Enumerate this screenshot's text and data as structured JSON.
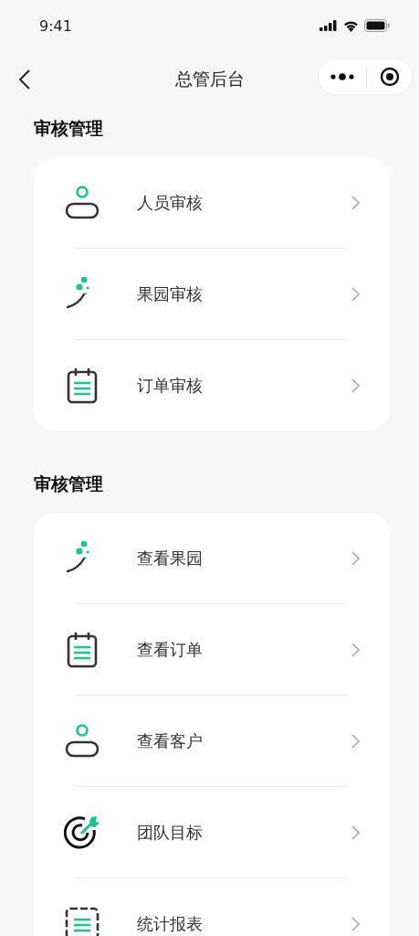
{
  "status_bar": {
    "time": "9:41"
  },
  "nav": {
    "title": "总管后台"
  },
  "sections": [
    {
      "title": "审核管理",
      "items": [
        {
          "label": "人员审核",
          "kind": "person"
        },
        {
          "label": "果园审核",
          "kind": "orchard"
        },
        {
          "label": "订单审核",
          "kind": "clipboard"
        }
      ]
    },
    {
      "title": "审核管理",
      "items": [
        {
          "label": "查看果园",
          "kind": "orchard"
        },
        {
          "label": "查看订单",
          "kind": "clipboard"
        },
        {
          "label": "查看客户",
          "kind": "person"
        },
        {
          "label": "团队目标",
          "kind": "target"
        },
        {
          "label": "统计报表",
          "kind": "report"
        }
      ]
    }
  ]
}
